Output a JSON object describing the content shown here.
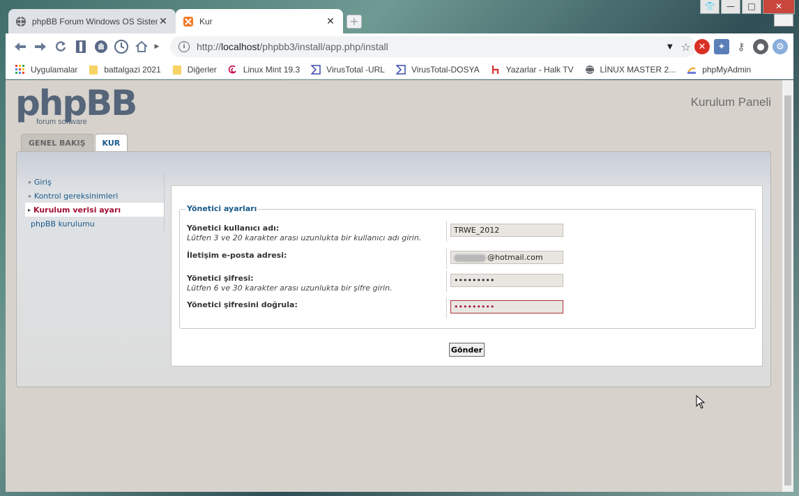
{
  "browser": {
    "tabs": [
      {
        "title": "phpBB Forum Windows OS Sistem",
        "close": "✕"
      },
      {
        "title": "Kur",
        "close": "✕"
      }
    ],
    "url_prefix": "http://",
    "url_host": "localhost",
    "url_path": "/phpbb3/install/app.php/install",
    "bookmarks": [
      {
        "label": "Uygulamalar",
        "icon": "apps-grid-icon"
      },
      {
        "label": "battalgazi 2021",
        "icon": "folder-icon"
      },
      {
        "label": "Diğerler",
        "icon": "folder-icon"
      },
      {
        "label": "Linux Mint 19.3",
        "icon": "debian-swirl-icon"
      },
      {
        "label": "VirusTotal -URL",
        "icon": "virustotal-icon"
      },
      {
        "label": "VirusTotal-DOSYA",
        "icon": "virustotal-icon"
      },
      {
        "label": "Yazarlar - Halk TV",
        "icon": "halktv-icon"
      },
      {
        "label": "LİNUX MASTER 2...",
        "icon": "globe-icon"
      },
      {
        "label": "phpMyAdmin",
        "icon": "pma-icon"
      }
    ]
  },
  "page": {
    "logo_text": "phpBB",
    "logo_sub": "forum software",
    "panel_title": "Kurulum Paneli",
    "tabs": [
      "GENEL BAKIŞ",
      "KUR"
    ],
    "menu": [
      {
        "label": "Giriş"
      },
      {
        "label": "Kontrol gereksinimleri"
      },
      {
        "label": "Kurulum verisi ayarı"
      },
      {
        "label": "phpBB kurulumu"
      }
    ],
    "legend": "Yönetici ayarları",
    "fields": [
      {
        "label": "Yönetici kullanıcı adı:",
        "hint": "Lütfen 3 ve 20 karakter arası uzunlukta bir kullanıcı adı girin.",
        "value": "TRWE_2012"
      },
      {
        "label": "İletişim e-posta adresi:",
        "hint": "",
        "value": "@hotmail.com"
      },
      {
        "label": "Yönetici şifresi:",
        "hint": "Lütfen 6 ve 30 karakter arası uzunlukta bir şifre girin.",
        "value": "•••••••••"
      },
      {
        "label": "Yönetici şifresini doğrula:",
        "hint": "",
        "value": "•••••••••"
      }
    ],
    "submit_label": "Gönder"
  },
  "colors": {
    "accent": "#1a5a8a",
    "active_menu": "#a30f33",
    "page_bg": "#d7d3cc"
  }
}
